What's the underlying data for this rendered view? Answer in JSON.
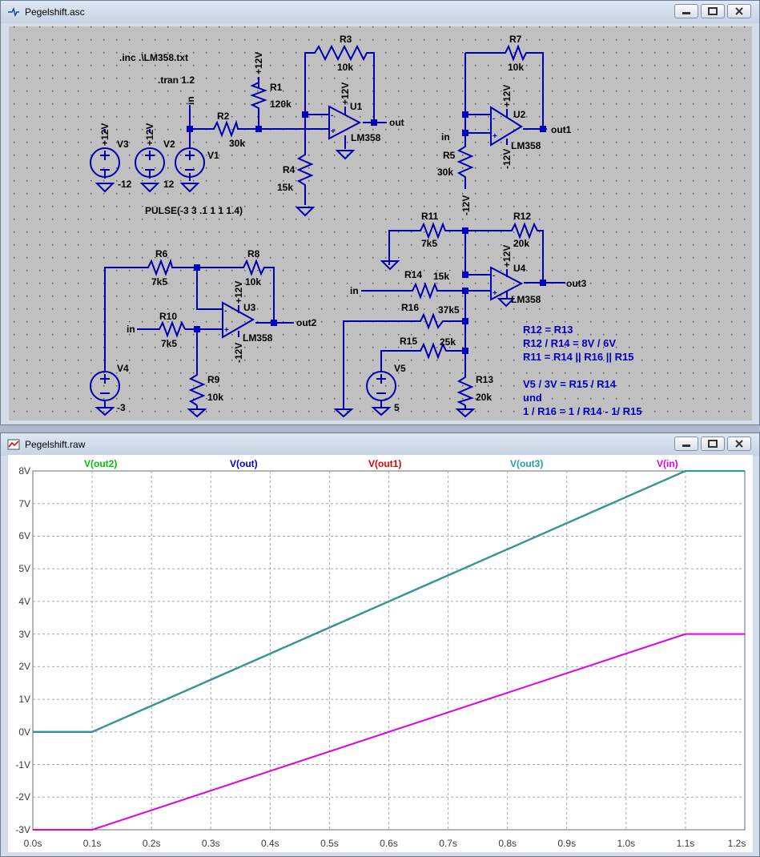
{
  "schematic_window": {
    "title": "Pegelshift.asc",
    "directives": {
      "inc": ".inc .\\LM358.txt",
      "tran": ".tran 1.2",
      "pulse": "PULSE(-3 3 .1 1 1 1.4)"
    },
    "components": {
      "V3": "V3",
      "V3_val": "-12",
      "V2": "V2",
      "V2_val": "12",
      "V1": "V1",
      "V4": "V4",
      "V4_val": "-3",
      "V5": "V5",
      "V5_val": "5",
      "R1": "R1",
      "R1_val": "120k",
      "R2": "R2",
      "R2_val": "30k",
      "R3": "R3",
      "R3_val": "10k",
      "R4": "R4",
      "R4_val": "15k",
      "R5": "R5",
      "R5_val": "30k",
      "R6": "R6",
      "R6_val": "7k5",
      "R7": "R7",
      "R7_val": "10k",
      "R8": "R8",
      "R8_val": "10k",
      "R9": "R9",
      "R9_val": "10k",
      "R10": "R10",
      "R10_val": "7k5",
      "R11": "R11",
      "R11_val": "7k5",
      "R12": "R12",
      "R12_val": "20k",
      "R13": "R13",
      "R13_val": "20k",
      "R14": "R14",
      "R14_val": "15k",
      "R15": "R15",
      "R15_val": "25k",
      "R16": "R16",
      "R16_val": "37k5",
      "U1": "U1",
      "U2": "U2",
      "U3": "U3",
      "U4": "U4",
      "opamp": "LM358"
    },
    "nets": {
      "pos12": "+12V",
      "neg12": "-12V",
      "in": "in",
      "out": "out",
      "out1": "out1",
      "out2": "out2",
      "out3": "out3"
    },
    "notes": [
      "R12 = R13",
      "R12 / R14 = 8V / 6V",
      "R11 = R14 || R16 || R15",
      "V5 / 3V = R15 / R14",
      "und",
      "1 / R16 = 1 / R14 - 1/ R15"
    ]
  },
  "waveform_window": {
    "title": "Pegelshift.raw",
    "colors": {
      "out2": "#00c000",
      "out": "#0000d0",
      "out1": "#e00000",
      "out3": "#20a0a0",
      "in": "#e000e0"
    },
    "chart_data": {
      "type": "line",
      "xlabel": "",
      "ylabel": "",
      "xlim": [
        0,
        1.2
      ],
      "ylim": [
        -3,
        8
      ],
      "grid": true,
      "legend": "top",
      "x_ticks": [
        "0.0s",
        "0.1s",
        "0.2s",
        "0.3s",
        "0.4s",
        "0.5s",
        "0.6s",
        "0.7s",
        "0.8s",
        "0.9s",
        "1.0s",
        "1.1s",
        "1.2s"
      ],
      "y_ticks": [
        "8V",
        "7V",
        "6V",
        "5V",
        "4V",
        "3V",
        "2V",
        "1V",
        "0V",
        "-1V",
        "-2V",
        "-3V"
      ],
      "series": [
        {
          "name": "V(out2)",
          "color": "#00c000",
          "x": [
            0,
            0.1,
            1.1,
            1.2
          ],
          "y": [
            0,
            0,
            8,
            8
          ]
        },
        {
          "name": "V(out)",
          "color": "#0000d0",
          "x": [
            0,
            0.1,
            1.1,
            1.2
          ],
          "y": [
            0,
            0,
            8,
            8
          ]
        },
        {
          "name": "V(out1)",
          "color": "#e00000",
          "x": [
            0,
            0.1,
            1.1,
            1.2
          ],
          "y": [
            0,
            0,
            8,
            8
          ]
        },
        {
          "name": "V(out3)",
          "color": "#20a0a0",
          "x": [
            0,
            0.1,
            1.1,
            1.2
          ],
          "y": [
            0,
            0,
            8,
            8
          ]
        },
        {
          "name": "V(in)",
          "color": "#e000e0",
          "x": [
            0,
            0.1,
            1.1,
            1.2
          ],
          "y": [
            -3,
            -3,
            3,
            3
          ]
        }
      ]
    }
  }
}
